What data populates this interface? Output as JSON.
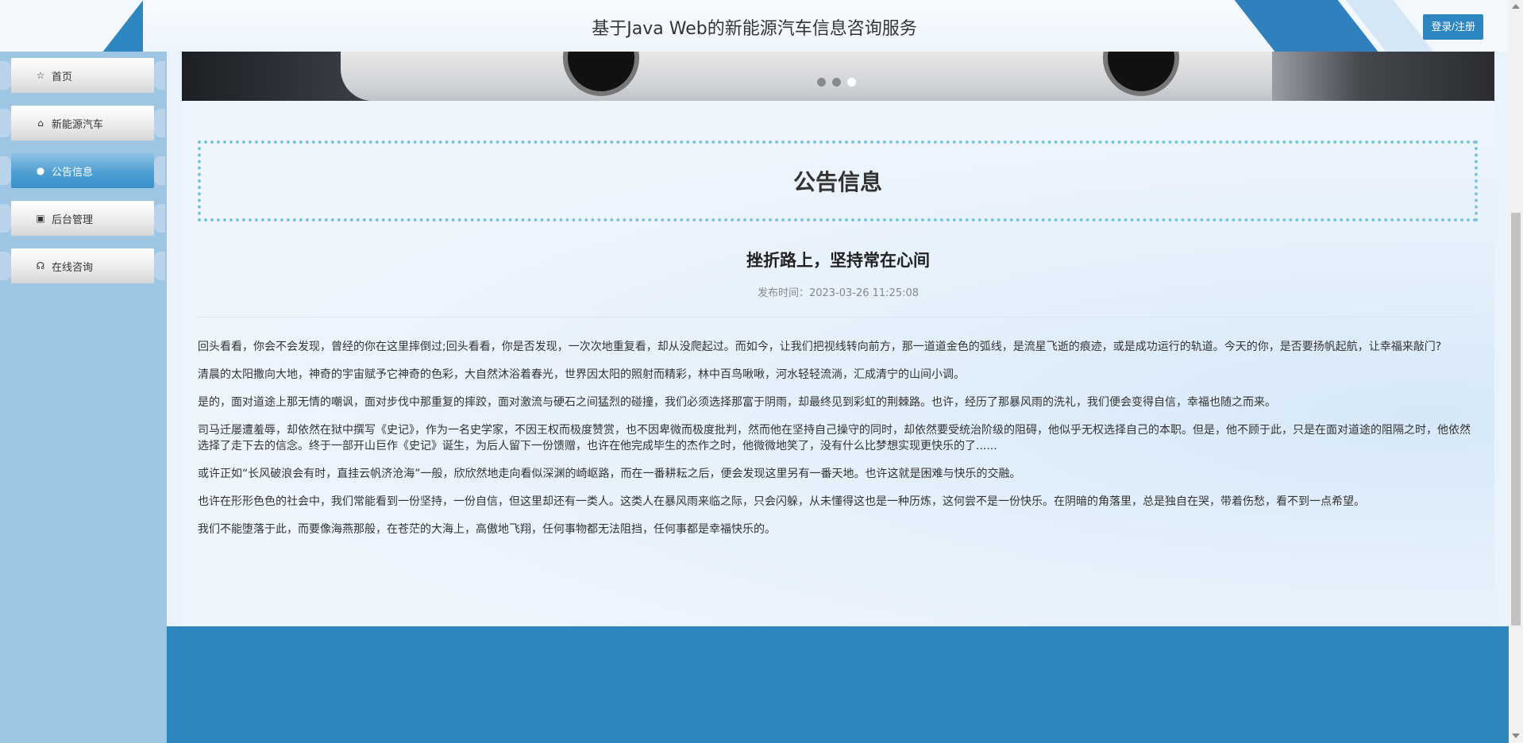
{
  "header": {
    "title": "基于Java Web的新能源汽车信息咨询服务",
    "login_label": "登录/注册"
  },
  "sidebar": {
    "items": [
      {
        "label": "首页",
        "icon": "home-icon",
        "glyph": "☆",
        "active": false
      },
      {
        "label": "新能源汽车",
        "icon": "bag-icon",
        "glyph": "⌂",
        "active": false
      },
      {
        "label": "公告信息",
        "icon": "notice-icon",
        "glyph": "●",
        "active": true
      },
      {
        "label": "后台管理",
        "icon": "briefcase-icon",
        "glyph": "▣",
        "active": false
      },
      {
        "label": "在线咨询",
        "icon": "headset-icon",
        "glyph": "☊",
        "active": false
      }
    ]
  },
  "banner": {
    "slides": 3,
    "current_slide": 3
  },
  "main": {
    "section_title": "公告信息",
    "article": {
      "title": "挫折路上，坚持常在心间",
      "publish_time": "发布时间：2023-03-26 11:25:08",
      "paragraphs": [
        "回头看看，你会不会发现，曾经的你在这里摔倒过;回头看看，你是否发现，一次次地重复看，却从没爬起过。而如今，让我们把视线转向前方，那一道道金色的弧线，是流星飞逝的痕迹，或是成功运行的轨道。今天的你，是否要扬帆起航，让幸福来敲门?",
        "清晨的太阳撒向大地，神奇的宇宙赋予它神奇的色彩，大自然沐浴着春光，世界因太阳的照射而精彩，林中百鸟啾啾，河水轻轻流淌，汇成清宁的山间小调。",
        "是的，面对道途上那无情的嘲讽，面对步伐中那重复的摔跤，面对激流与硬石之间猛烈的碰撞，我们必须选择那富于阴雨，却最终见到彩虹的荆棘路。也许，经历了那暴风雨的洗礼，我们便会变得自信，幸福也随之而来。",
        "司马迁屡遭羞辱，却依然在狱中撰写《史记》，作为一名史学家，不因王权而极度赞赏，也不因卑微而极度批判，然而他在坚持自己操守的同时，却依然要受统治阶级的阻碍，他似乎无权选择自己的本职。但是，他不顾于此，只是在面对道途的阻隔之时，他依然选择了走下去的信念。终于一部开山巨作《史记》诞生，为后人留下一份馈赠，也许在他完成毕生的杰作之时，他微微地笑了，没有什么比梦想实现更快乐的了......",
        "或许正如“长风破浪会有时，直挂云帆济沧海”一般，欣欣然地走向看似深渊的崎岖路，而在一番耕耘之后，便会发现这里另有一番天地。也许这就是困难与快乐的交融。",
        "也许在形形色色的社会中，我们常能看到一份坚持，一份自信，但这里却还有一类人。这类人在暴风雨来临之际，只会闪躲，从未懂得这也是一种历炼，这何尝不是一份快乐。在阴暗的角落里，总是独自在哭，带着伤愁，看不到一点希望。",
        "我们不能堕落于此，而要像海燕那般，在苍茫的大海上，高傲地飞翔，任何事物都无法阻挡，任何事都是幸福快乐的。"
      ]
    }
  },
  "colors": {
    "accent": "#2e86c1",
    "sidebar_bg": "#9dc6e4",
    "footer_bg": "#2d86bd",
    "section_border": "#7cc4d8"
  }
}
